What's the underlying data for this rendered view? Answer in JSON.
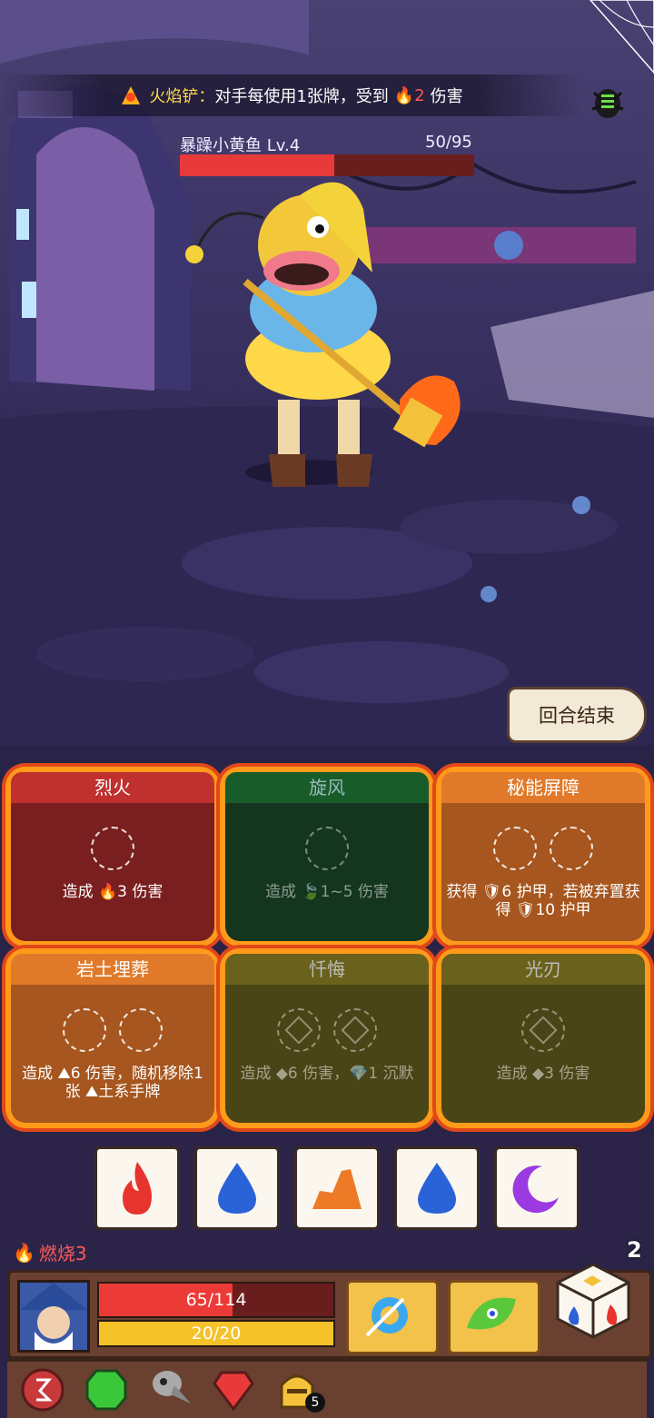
{
  "buff": {
    "name": "火焰铲",
    "separator": "：",
    "text": "对手每使用1张牌，受到",
    "damage": "2",
    "suffix": "伤害"
  },
  "enemy": {
    "name": "暴躁小黄鱼 Lv.4",
    "hp_text": "50/95",
    "hp_fraction": 0.526
  },
  "end_turn_label": "回合结束",
  "cards": [
    {
      "title": "烈火",
      "desc": "造成 🔥3 伤害"
    },
    {
      "title": "旋风",
      "desc": "造成 🍃1~5 伤害"
    },
    {
      "title": "秘能屏障",
      "desc": "获得 🛡6 护甲，若被弃置获得 🛡10 护甲"
    },
    {
      "title": "岩土埋葬",
      "desc": "造成 ⛰6 伤害，随机移除1张 ⛰土系手牌"
    },
    {
      "title": "忏悔",
      "desc": "造成 ◆6 伤害，💎1 沉默"
    },
    {
      "title": "光刃",
      "desc": "造成 ◆3 伤害"
    }
  ],
  "dice": [
    "fire",
    "water",
    "earth",
    "water",
    "moon"
  ],
  "status": {
    "burn": "燃烧3"
  },
  "dice_remaining": "2",
  "player": {
    "hp_text": "65/114",
    "hp_fraction": 0.57,
    "armor_text": "20/20",
    "armor_fraction": 1.0
  },
  "relic_badge": "5",
  "colors": {
    "fire": "#e8342e",
    "water": "#2a62d8",
    "earth": "#ec7a26",
    "moon": "#9a3ae0"
  }
}
